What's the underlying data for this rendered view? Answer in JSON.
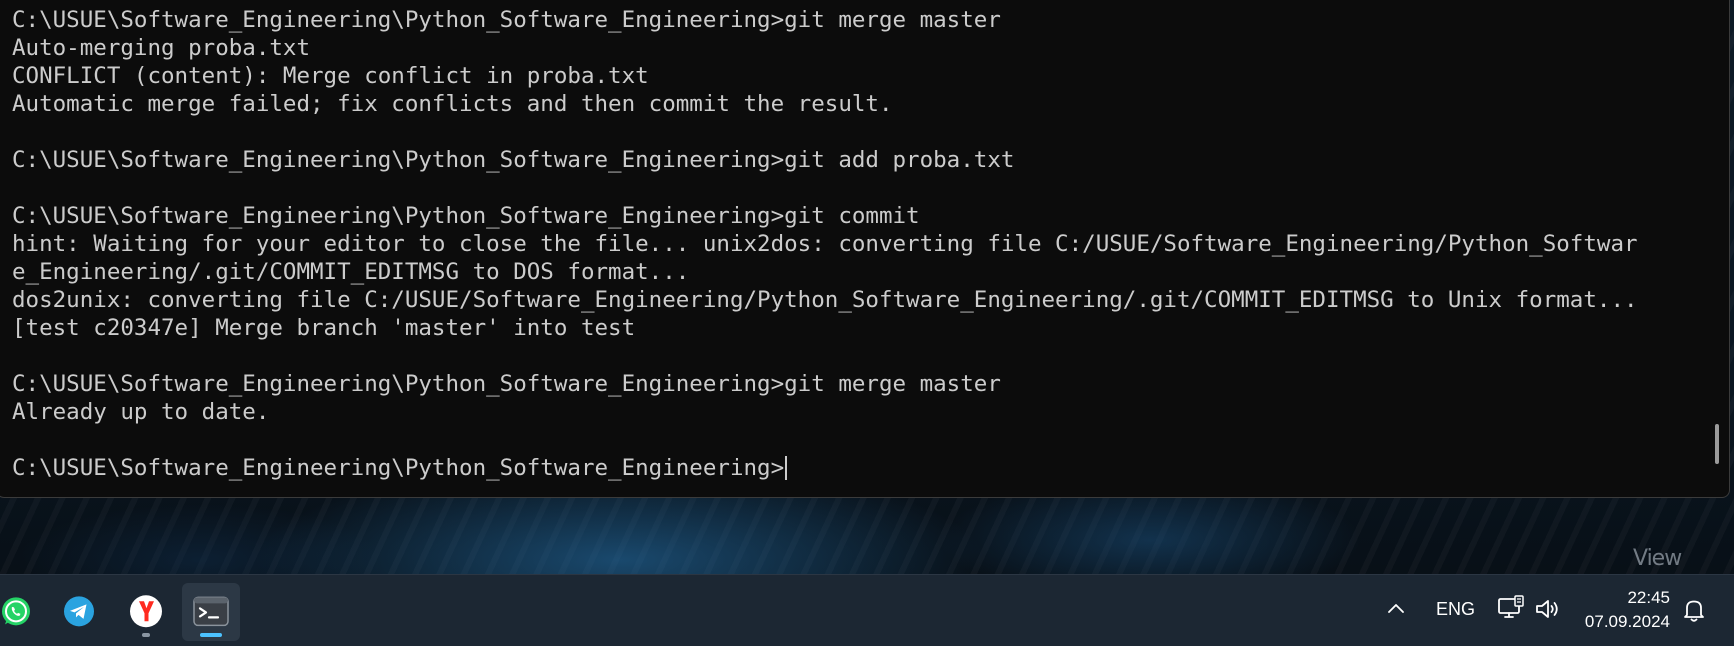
{
  "terminal": {
    "lines": [
      "C:\\USUE\\Software_Engineering\\Python_Software_Engineering>git merge master",
      "Auto-merging proba.txt",
      "CONFLICT (content): Merge conflict in proba.txt",
      "Automatic merge failed; fix conflicts and then commit the result.",
      "",
      "C:\\USUE\\Software_Engineering\\Python_Software_Engineering>git add proba.txt",
      "",
      "C:\\USUE\\Software_Engineering\\Python_Software_Engineering>git commit",
      "hint: Waiting for your editor to close the file... unix2dos: converting file C:/USUE/Software_Engineering/Python_Softwar",
      "e_Engineering/.git/COMMIT_EDITMSG to DOS format...",
      "dos2unix: converting file C:/USUE/Software_Engineering/Python_Software_Engineering/.git/COMMIT_EDITMSG to Unix format...",
      "[test c20347e] Merge branch 'master' into test",
      "",
      "C:\\USUE\\Software_Engineering\\Python_Software_Engineering>git merge master",
      "Already up to date.",
      ""
    ],
    "prompt": "C:\\USUE\\Software_Engineering\\Python_Software_Engineering>"
  },
  "desktop": {
    "watermark": "View"
  },
  "taskbar": {
    "apps": [
      {
        "name": "whatsapp",
        "icon": "whatsapp-icon",
        "color": "#25d366"
      },
      {
        "name": "telegram",
        "icon": "telegram-icon",
        "color": "#2aa3e0"
      },
      {
        "name": "yandex-browser",
        "icon": "yandex-browser-icon",
        "color": "#ff2a1f"
      },
      {
        "name": "terminal",
        "icon": "terminal-icon",
        "color": "#3a3f46"
      }
    ],
    "tray": {
      "language": "ENG",
      "time": "22:45",
      "date": "07.09.2024"
    }
  },
  "colors": {
    "terminal_bg": "#0c0c0c",
    "terminal_text": "#cccccc",
    "taskbar_bg": "#1c2733",
    "active_indicator": "#4cc2ff"
  }
}
